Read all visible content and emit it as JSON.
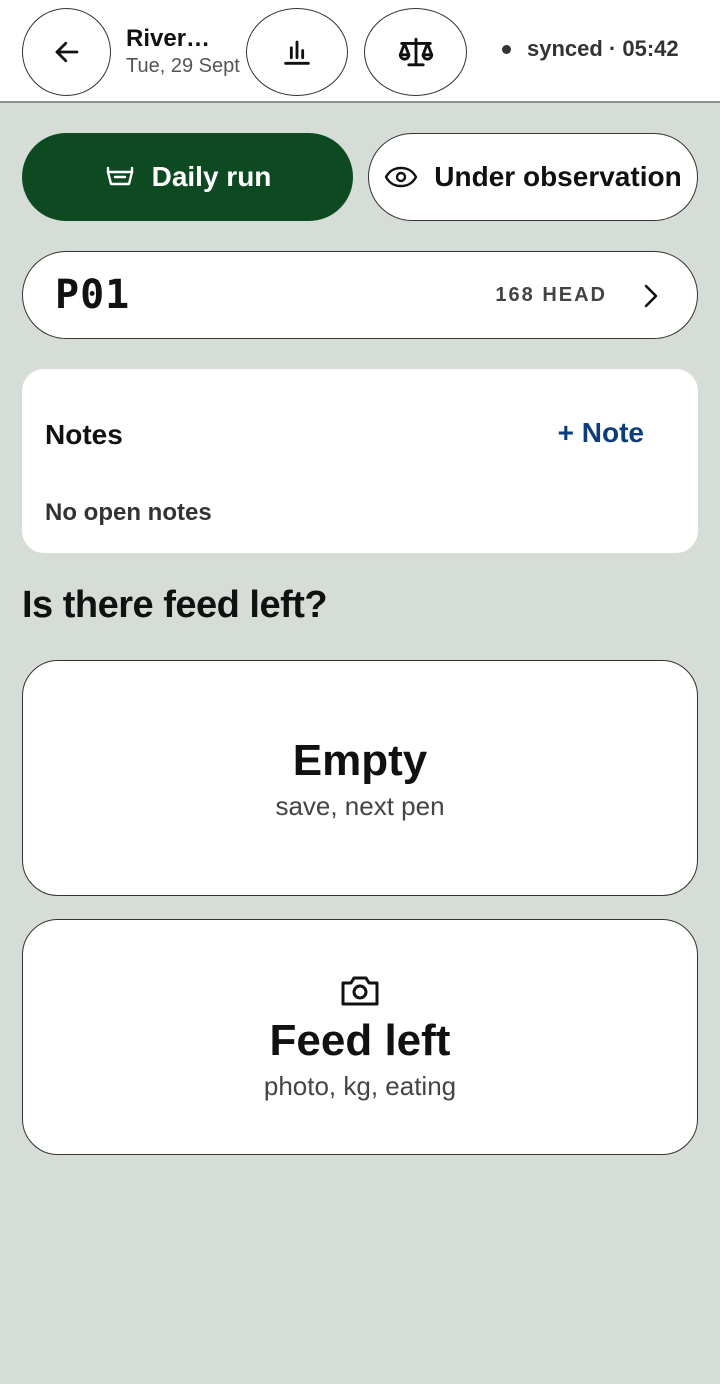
{
  "header": {
    "site_name": "River…",
    "date": "Tue, 29 Sept",
    "sync_status": "synced · 05:42",
    "icons": [
      "arrow-left-icon",
      "bar-chart-icon",
      "scale-icon"
    ]
  },
  "modes": {
    "daily_run": {
      "label": "Daily run",
      "icon": "feed-bunk-icon",
      "active": true
    },
    "observation": {
      "label": "Under observation",
      "icon": "eye-icon",
      "active": false
    }
  },
  "pen": {
    "id": "P01",
    "head_count": "168 HEAD"
  },
  "notes": {
    "title": "Notes",
    "add_label": "+ Note",
    "empty_text": "No open notes"
  },
  "question": "Is there feed left?",
  "choices": {
    "empty": {
      "title": "Empty",
      "subtitle": "save, next pen"
    },
    "feed_left": {
      "title": "Feed left",
      "subtitle": "photo, kg, eating",
      "icon": "camera-icon"
    }
  },
  "colors": {
    "background": "#d6ddd6",
    "accent": "#0d4a22",
    "link": "#0b3d7a"
  }
}
